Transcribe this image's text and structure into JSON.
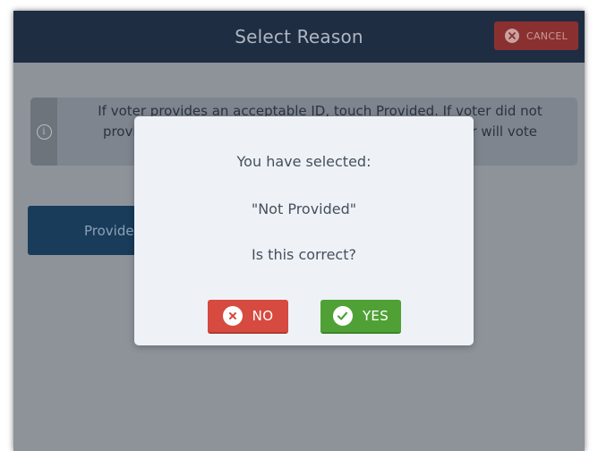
{
  "header": {
    "title": "Select Reason",
    "cancel_label": "CANCEL"
  },
  "info": {
    "text": "If voter provides an acceptable ID, touch Provided. If voter did not provide an acceptable ID, touch Not Provided and voter will vote"
  },
  "buttons": {
    "provided_label": "Provided"
  },
  "dialog": {
    "line1": "You have selected:",
    "selection": "\"Not Provided\"",
    "question": "Is this correct?",
    "no_label": "NO",
    "yes_label": "YES"
  },
  "colors": {
    "header_bg": "#1f2d43",
    "no_button": "#d64a3f",
    "yes_button": "#4fa135"
  }
}
